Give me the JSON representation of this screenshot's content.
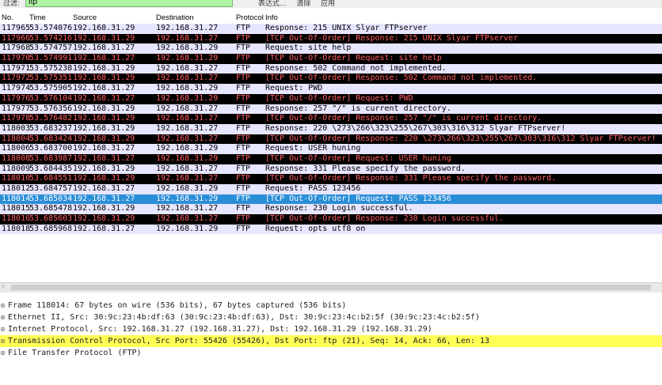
{
  "filter": {
    "label": "过滤:",
    "value": "ftp",
    "buttons": [
      "表达式…",
      "清除",
      "应用"
    ]
  },
  "columns": {
    "no": "No.",
    "time": "Time",
    "source": "Source",
    "destination": "Destination",
    "protocol": "Protocol",
    "info": "Info"
  },
  "packets": [
    {
      "no": "117965",
      "time": "53.574076",
      "src": "192.168.31.29",
      "dst": "192.168.31.27",
      "proto": "FTP",
      "info": "Response: 215 UNIX Slyar FTPserver",
      "style": "normal"
    },
    {
      "no": "117966",
      "time": "53.574216",
      "src": "192.168.31.29",
      "dst": "192.168.31.27",
      "proto": "FTP",
      "info": "[TCP Out-Of-Order] Response: 215 UNIX Slyar FTPserver",
      "style": "ooo"
    },
    {
      "no": "117968",
      "time": "53.574757",
      "src": "192.168.31.27",
      "dst": "192.168.31.29",
      "proto": "FTP",
      "info": "Request: site help",
      "style": "normal"
    },
    {
      "no": "117970",
      "time": "53.574991",
      "src": "192.168.31.27",
      "dst": "192.168.31.29",
      "proto": "FTP",
      "info": "[TCP Out-Of-Order] Request: site help",
      "style": "ooo"
    },
    {
      "no": "117971",
      "time": "53.575238",
      "src": "192.168.31.29",
      "dst": "192.168.31.27",
      "proto": "FTP",
      "info": "Response: 502 Command not implemented.",
      "style": "normal"
    },
    {
      "no": "117972",
      "time": "53.575351",
      "src": "192.168.31.29",
      "dst": "192.168.31.27",
      "proto": "FTP",
      "info": "[TCP Out-Of-Order] Response: 502 Command not implemented.",
      "style": "ooo"
    },
    {
      "no": "117974",
      "time": "53.575905",
      "src": "192.168.31.27",
      "dst": "192.168.31.29",
      "proto": "FTP",
      "info": "Request: PWD",
      "style": "normal"
    },
    {
      "no": "117976",
      "time": "53.576104",
      "src": "192.168.31.27",
      "dst": "192.168.31.29",
      "proto": "FTP",
      "info": "[TCP Out-Of-Order] Request: PWD",
      "style": "ooo"
    },
    {
      "no": "117977",
      "time": "53.576356",
      "src": "192.168.31.29",
      "dst": "192.168.31.27",
      "proto": "FTP",
      "info": "Response: 257 \"/\" is current directory.",
      "style": "normal"
    },
    {
      "no": "117978",
      "time": "53.576482",
      "src": "192.168.31.29",
      "dst": "192.168.31.27",
      "proto": "FTP",
      "info": "[TCP Out-Of-Order] Response: 257 \"/\" is current directory.",
      "style": "ooo"
    },
    {
      "no": "118003",
      "time": "53.683237",
      "src": "192.168.31.29",
      "dst": "192.168.31.27",
      "proto": "FTP",
      "info": "Response: 220 \\273\\266\\323\\255\\267\\303\\316\\312 Slyar FTPserver!",
      "style": "normal"
    },
    {
      "no": "118004",
      "time": "53.683424",
      "src": "192.168.31.29",
      "dst": "192.168.31.27",
      "proto": "FTP",
      "info": "[TCP Out-Of-Order] Response: 220 \\273\\266\\323\\255\\267\\303\\316\\312 Slyar FTPserver!",
      "style": "ooo"
    },
    {
      "no": "118006",
      "time": "53.683700",
      "src": "192.168.31.27",
      "dst": "192.168.31.29",
      "proto": "FTP",
      "info": "Request: USER huning",
      "style": "normal"
    },
    {
      "no": "118008",
      "time": "53.683987",
      "src": "192.168.31.27",
      "dst": "192.168.31.29",
      "proto": "FTP",
      "info": "[TCP Out-Of-Order] Request: USER huning",
      "style": "ooo"
    },
    {
      "no": "118009",
      "time": "53.684435",
      "src": "192.168.31.29",
      "dst": "192.168.31.27",
      "proto": "FTP",
      "info": "Response: 331 Please specify the password.",
      "style": "normal"
    },
    {
      "no": "118010",
      "time": "53.684551",
      "src": "192.168.31.29",
      "dst": "192.168.31.27",
      "proto": "FTP",
      "info": "[TCP Out-Of-Order] Response: 331 Please specify the password.",
      "style": "ooo"
    },
    {
      "no": "118012",
      "time": "53.684757",
      "src": "192.168.31.27",
      "dst": "192.168.31.29",
      "proto": "FTP",
      "info": "Request: PASS 123456",
      "style": "normal"
    },
    {
      "no": "118014",
      "time": "53.685034",
      "src": "192.168.31.27",
      "dst": "192.168.31.29",
      "proto": "FTP",
      "info": "[TCP Out-Of-Order] Request: PASS 123456",
      "style": "sel"
    },
    {
      "no": "118015",
      "time": "53.685478",
      "src": "192.168.31.29",
      "dst": "192.168.31.27",
      "proto": "FTP",
      "info": "Response: 230 Login successful.",
      "style": "normal"
    },
    {
      "no": "118016",
      "time": "53.685603",
      "src": "192.168.31.29",
      "dst": "192.168.31.27",
      "proto": "FTP",
      "info": "[TCP Out-Of-Order] Response: 230 Login successful.",
      "style": "ooo"
    },
    {
      "no": "118018",
      "time": "53.685968",
      "src": "192.168.31.27",
      "dst": "192.168.31.29",
      "proto": "FTP",
      "info": "Request: opts utf8 on",
      "style": "normal"
    }
  ],
  "details": [
    {
      "text": "Frame 118014: 67 bytes on wire (536 bits), 67 bytes captured (536 bits)",
      "highlight": false
    },
    {
      "text": "Ethernet II, Src: 30:9c:23:4b:df:63 (30:9c:23:4b:df:63), Dst: 30:9c:23:4c:b2:5f (30:9c:23:4c:b2:5f)",
      "highlight": false
    },
    {
      "text": "Internet Protocol, Src: 192.168.31.27 (192.168.31.27), Dst: 192.168.31.29 (192.168.31.29)",
      "highlight": false
    },
    {
      "text": "Transmission Control Protocol, Src Port: 55426 (55426), Dst Port: ftp (21), Seq: 14, Ack: 66, Len: 13",
      "highlight": true
    },
    {
      "text": "File Transfer Protocol (FTP)",
      "highlight": false
    }
  ],
  "icons": {
    "expand": "expand-plus-icon",
    "scroll_left": "scroll-left-arrow-icon"
  },
  "colors": {
    "normal_row": "#e7e6ff",
    "ooo_row_bg": "#000000",
    "ooo_row_fg": "#ff5f5f",
    "selected_row": "#2a8ed7",
    "filter_bg": "#aff5a3",
    "detail_highlight": "#ffff55"
  }
}
